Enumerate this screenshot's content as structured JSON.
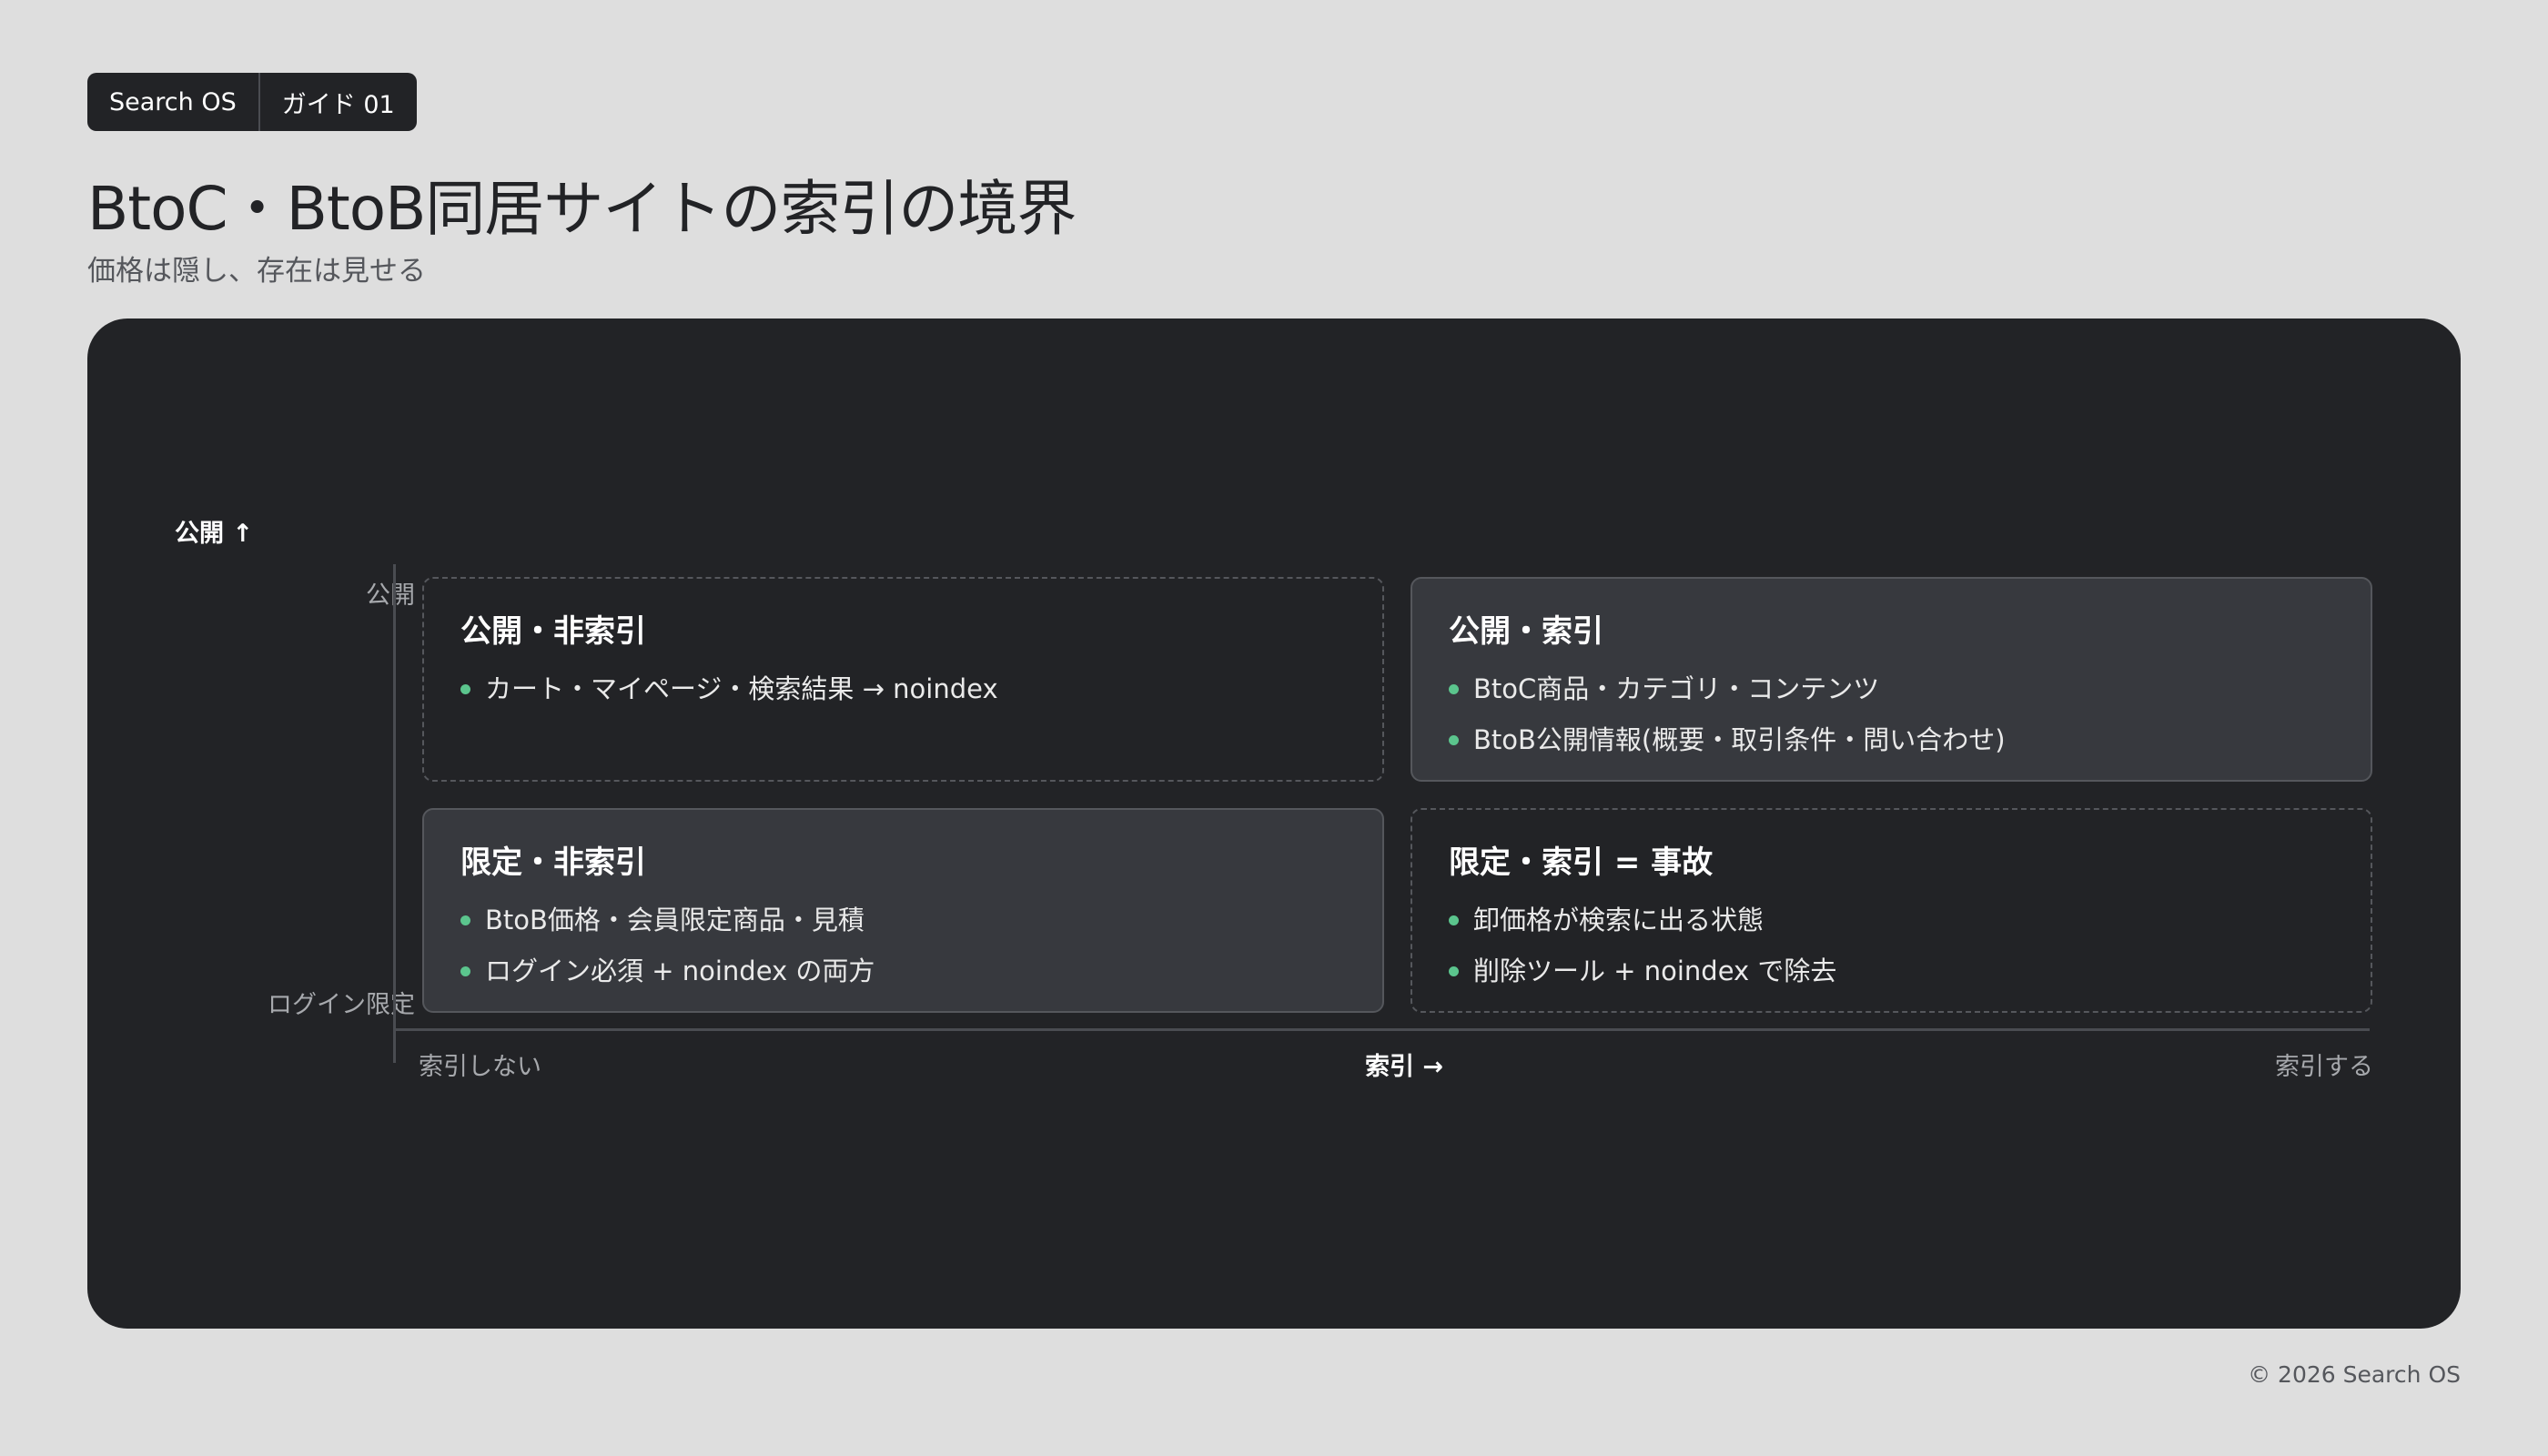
{
  "tag": {
    "brand": "Search OS",
    "guide": "ガイド 01"
  },
  "title": "BtoC・BtoB同居サイトの索引の境界",
  "subtitle": "価格は隠し、存在は見せる",
  "matrix": {
    "y_axis_title": "公開 ↑",
    "y_high": "公開",
    "y_low": "ログイン限定",
    "x_low": "索引しない",
    "x_axis_title": "索引 →",
    "x_high": "索引する",
    "quadrants": {
      "top_left": {
        "title": "公開・非索引",
        "items": [
          "カート・マイページ・検索結果 → noindex"
        ]
      },
      "top_right": {
        "title": "公開・索引",
        "items": [
          "BtoC商品・カテゴリ・コンテンツ",
          "BtoB公開情報(概要・取引条件・問い合わせ)"
        ]
      },
      "bottom_left": {
        "title": "限定・非索引",
        "items": [
          "BtoB価格・会員限定商品・見積",
          "ログイン必須 + noindex の両方"
        ]
      },
      "bottom_right": {
        "title": "限定・索引 = 事故",
        "items": [
          "卸価格が検索に出る状態",
          "削除ツール + noindex で除去"
        ]
      }
    }
  },
  "footer": "© 2026 Search OS",
  "colors": {
    "background": "#dedede",
    "panel": "#222326",
    "bullet": "#5bc58d",
    "card": "#37393e"
  }
}
